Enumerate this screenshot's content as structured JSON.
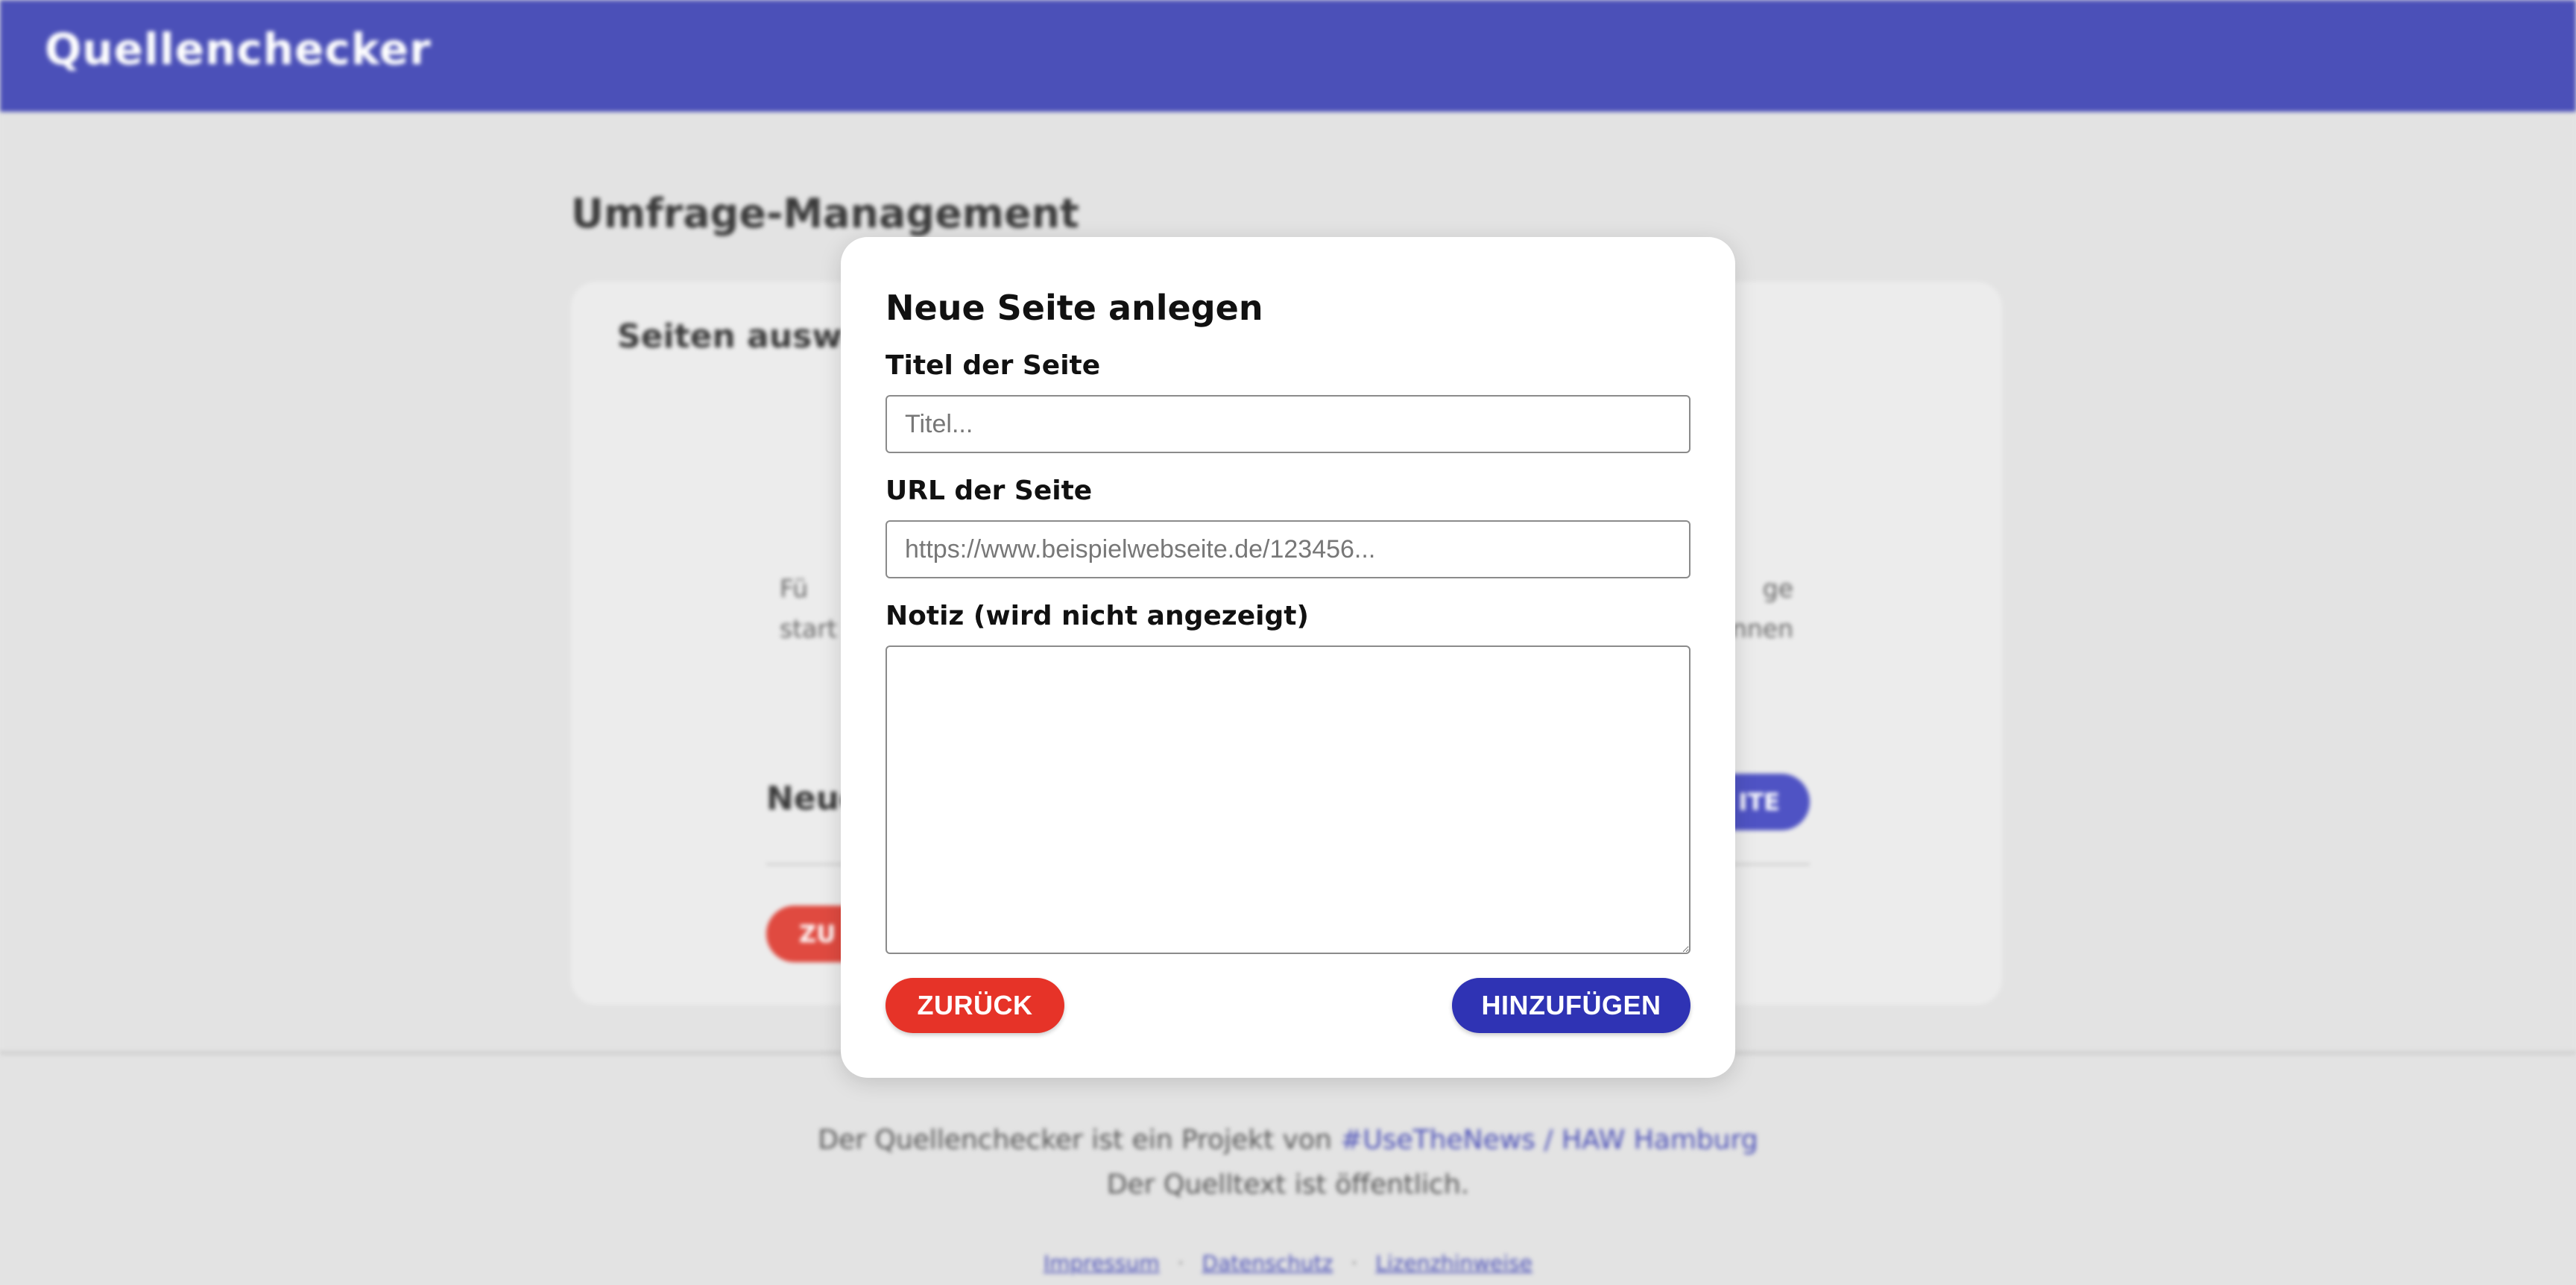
{
  "header": {
    "brand": "Quellenchecker"
  },
  "page": {
    "title": "Umfrage-Management",
    "card_title": "Seiten auswählen",
    "card_text_left_1": "Fü",
    "card_text_left_2": "start",
    "card_text_right_1": "ge",
    "card_text_right_2": "nnen",
    "card_subhead": "Neue",
    "bg_blue_button": "ITE",
    "bg_red_button": "ZU"
  },
  "modal": {
    "title": "Neue Seite anlegen",
    "title_label": "Titel der Seite",
    "title_placeholder": "Titel...",
    "url_label": "URL der Seite",
    "url_placeholder": "https://www.beispielwebseite.de/123456...",
    "note_label": "Notiz (wird nicht angezeigt)",
    "back_button": "ZURÜCK",
    "add_button": "HINZUFÜGEN"
  },
  "footer": {
    "text_before": "Der Quellenchecker ist ein Projekt von ",
    "link_usethenews": "#UseTheNews",
    "separator": " / ",
    "link_haw": "HAW Hamburg",
    "line2": "Der Quelltext ist öffentlich.",
    "links": [
      "Impressum",
      "Datenschutz",
      "Lizenzhinweise"
    ],
    "dot": "·"
  },
  "colors": {
    "header": "#4b50b8",
    "back_button": "#e63328",
    "add_button": "#2f33b4"
  }
}
